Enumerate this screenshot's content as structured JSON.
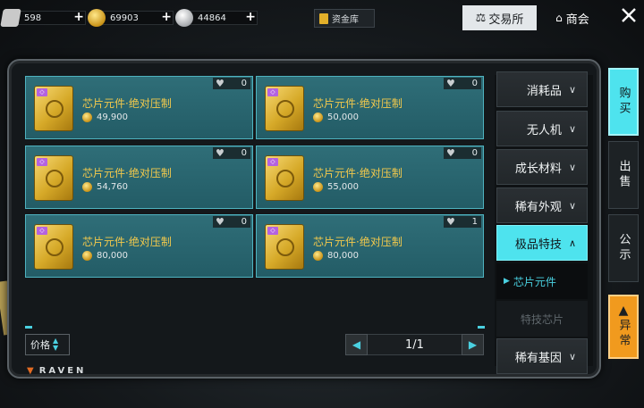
{
  "topbar": {
    "currencies": [
      {
        "icon": "card-ticket-icon",
        "value": "598"
      },
      {
        "icon": "gold-coin-icon",
        "value": "69903"
      },
      {
        "icon": "silver-coin-icon",
        "value": "44864"
      }
    ],
    "vault_label": "资金库",
    "exchange_label": "交易所",
    "guild_label": "商会"
  },
  "listings": [
    {
      "name": "芯片元件·绝对压制",
      "price": "49,900",
      "favorites": "0"
    },
    {
      "name": "芯片元件·绝对压制",
      "price": "50,000",
      "favorites": "0"
    },
    {
      "name": "芯片元件·绝对压制",
      "price": "54,760",
      "favorites": "0"
    },
    {
      "name": "芯片元件·绝对压制",
      "price": "55,000",
      "favorites": "0"
    },
    {
      "name": "芯片元件·绝对压制",
      "price": "80,000",
      "favorites": "0"
    },
    {
      "name": "芯片元件·绝对压制",
      "price": "80,000",
      "favorites": "1"
    }
  ],
  "sort_label": "价格",
  "pagination": {
    "current": "1/1"
  },
  "brand": "RAVEN",
  "categories": {
    "consumables": "消耗品",
    "drones": "无人机",
    "growth_materials": "成长材料",
    "rare_cosmetics": "稀有外观",
    "premium_skills": "极品特技",
    "chip_components": "芯片元件",
    "skill_chips": "特技芯片",
    "rare_genes": "稀有基因"
  },
  "side_tabs": {
    "buy": "购买",
    "sell": "出售",
    "notice": "公示",
    "abnormal": "异常"
  },
  "colors": {
    "accent": "#4ee3ee",
    "card": "#2f6e78",
    "gold_text": "#f2c94c",
    "alert": "#f19a1e"
  }
}
